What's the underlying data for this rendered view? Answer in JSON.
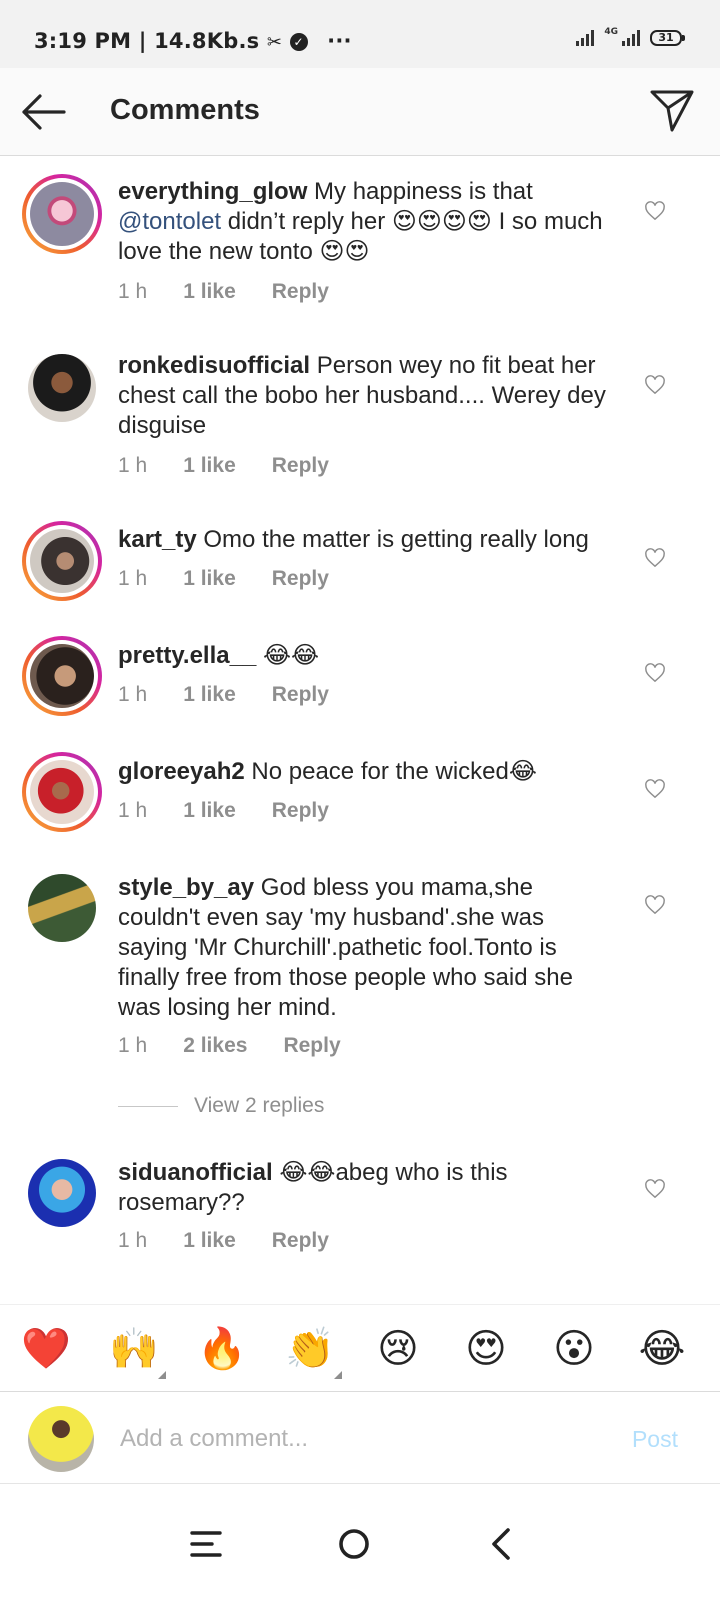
{
  "status_bar": {
    "left_text": "3:19 PM | 14.8Kb.s",
    "more": "···",
    "network": "4G",
    "battery": "31"
  },
  "header": {
    "title": "Comments"
  },
  "comments": [
    {
      "username": "everything_glow",
      "text_before": "My happiness is that",
      "mention": "@tontolet",
      "text_after": " didn’t reply her 😍😍😍😍 I so much love the new tonto 😍😍",
      "time": "1 h",
      "likes": "1 like",
      "reply": "Reply",
      "story_ring": true
    },
    {
      "username": "ronkedisuofficial",
      "text": "Person wey no fit beat her chest call the bobo her husband.... Werey dey disguise",
      "time": "1 h",
      "likes": "1 like",
      "reply": "Reply",
      "story_ring": false
    },
    {
      "username": "kart_ty",
      "text": "Omo the matter is getting really long",
      "time": "1 h",
      "likes": "1 like",
      "reply": "Reply",
      "story_ring": true
    },
    {
      "username": "pretty.ella__",
      "text": "😂😂",
      "time": "1 h",
      "likes": "1 like",
      "reply": "Reply",
      "story_ring": true
    },
    {
      "username": "gloreeyah2",
      "text": "No peace for the wicked😂",
      "time": "1 h",
      "likes": "1 like",
      "reply": "Reply",
      "story_ring": true
    },
    {
      "username": "style_by_ay",
      "text": "God bless you mama,she couldn't even say 'my husband'.she was saying 'Mr Churchill'.pathetic fool.Tonto is finally free from those people who said she was losing her mind.",
      "time": "1 h",
      "likes": "2 likes",
      "reply": "Reply",
      "story_ring": false
    },
    {
      "username": "siduanofficial",
      "text": "😂😂abeg who is this rosemary??",
      "time": "1 h",
      "likes": "1 like",
      "reply": "Reply",
      "story_ring": false
    }
  ],
  "view_replies": "View 2 replies",
  "emoji_bar": [
    "❤️",
    "🙌",
    "🔥",
    "👏",
    "😢",
    "😍",
    "😮",
    "😂"
  ],
  "comment_input": {
    "placeholder": "Add a comment...",
    "post_label": "Post"
  },
  "colors": {
    "mention": "#34517c",
    "post_disabled": "#b2dffc",
    "meta": "#8e8e8e"
  }
}
